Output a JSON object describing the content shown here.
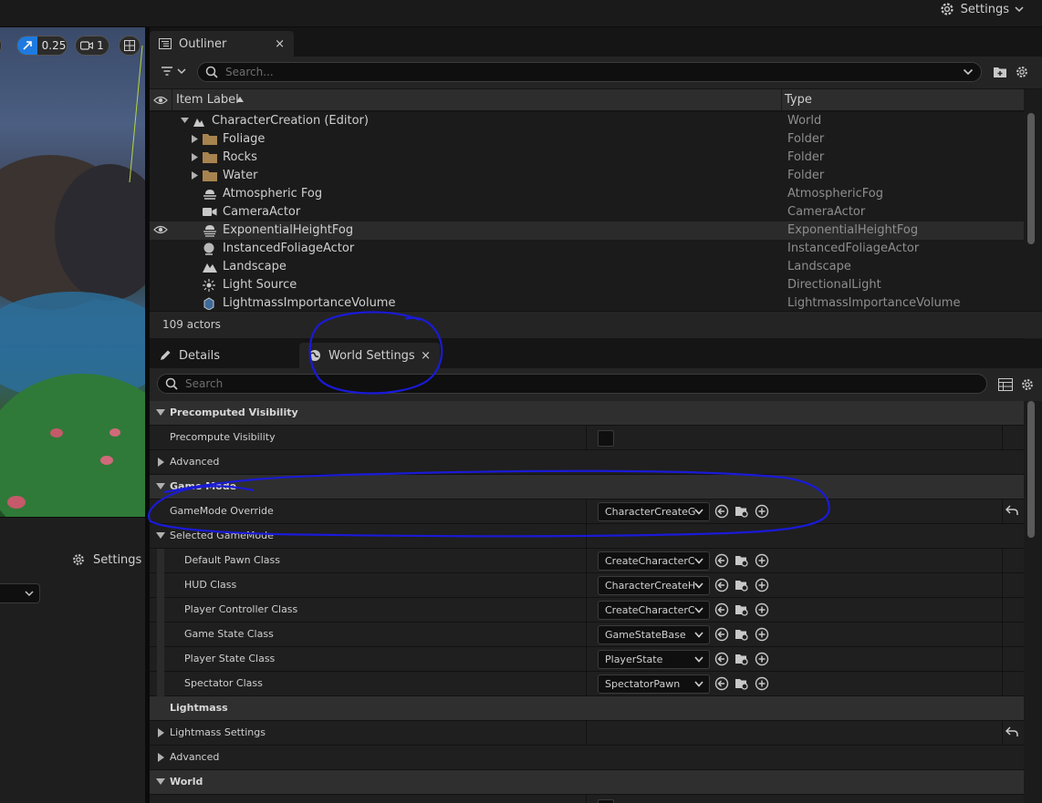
{
  "top": {
    "settings_label": "Settings"
  },
  "viewport": {
    "speed_value": "0.25",
    "camera_value": "1"
  },
  "left_panel": {
    "settings_label": "Settings"
  },
  "outliner": {
    "tab_label": "Outliner",
    "close_glyph": "×",
    "search_placeholder": "Search...",
    "col_label": "Item Label",
    "col_type": "Type",
    "footer": "109 actors",
    "rows": [
      {
        "label": "CharacterCreation (Editor)",
        "type": "World",
        "icon": "world-icon"
      },
      {
        "label": "Foliage",
        "type": "Folder",
        "icon": "folder-icon"
      },
      {
        "label": "Rocks",
        "type": "Folder",
        "icon": "folder-icon"
      },
      {
        "label": "Water",
        "type": "Folder",
        "icon": "folder-icon"
      },
      {
        "label": "Atmospheric Fog",
        "type": "AtmosphericFog",
        "icon": "fog-icon"
      },
      {
        "label": "CameraActor",
        "type": "CameraActor",
        "icon": "camera-icon"
      },
      {
        "label": "ExponentialHeightFog",
        "type": "ExponentialHeightFog",
        "icon": "height-fog-icon"
      },
      {
        "label": "InstancedFoliageActor",
        "type": "InstancedFoliageActor",
        "icon": "foliage-actor-icon"
      },
      {
        "label": "Landscape",
        "type": "Landscape",
        "icon": "landscape-icon"
      },
      {
        "label": "Light Source",
        "type": "DirectionalLight",
        "icon": "light-icon"
      },
      {
        "label": "LightmassImportanceVolume",
        "type": "LightmassImportanceVolume",
        "icon": "volume-icon"
      }
    ]
  },
  "details": {
    "details_tab": "Details",
    "world_settings_tab": "World Settings",
    "close_glyph": "×",
    "search_placeholder": "Search",
    "rows": [
      {
        "label": "Precomputed Visibility"
      },
      {
        "label": "Precompute Visibility"
      },
      {
        "label": "Advanced"
      },
      {
        "label": "Game Mode"
      },
      {
        "label": "GameMode Override",
        "value": "CharacterCreateG"
      },
      {
        "label": "Selected GameMode"
      },
      {
        "label": "Default Pawn Class",
        "value": "CreateCharacterC"
      },
      {
        "label": "HUD Class",
        "value": "CharacterCreateH"
      },
      {
        "label": "Player Controller Class",
        "value": "CreateCharacterC"
      },
      {
        "label": "Game State Class",
        "value": "GameStateBase"
      },
      {
        "label": "Player State Class",
        "value": "PlayerState"
      },
      {
        "label": "Spectator Class",
        "value": "SpectatorPawn"
      },
      {
        "label": "Lightmass"
      },
      {
        "label": "Lightmass Settings"
      },
      {
        "label": "Advanced"
      },
      {
        "label": "World"
      }
    ]
  },
  "colors": {
    "accent": "#1f7ae0",
    "annotation": "#1a1ad8"
  }
}
